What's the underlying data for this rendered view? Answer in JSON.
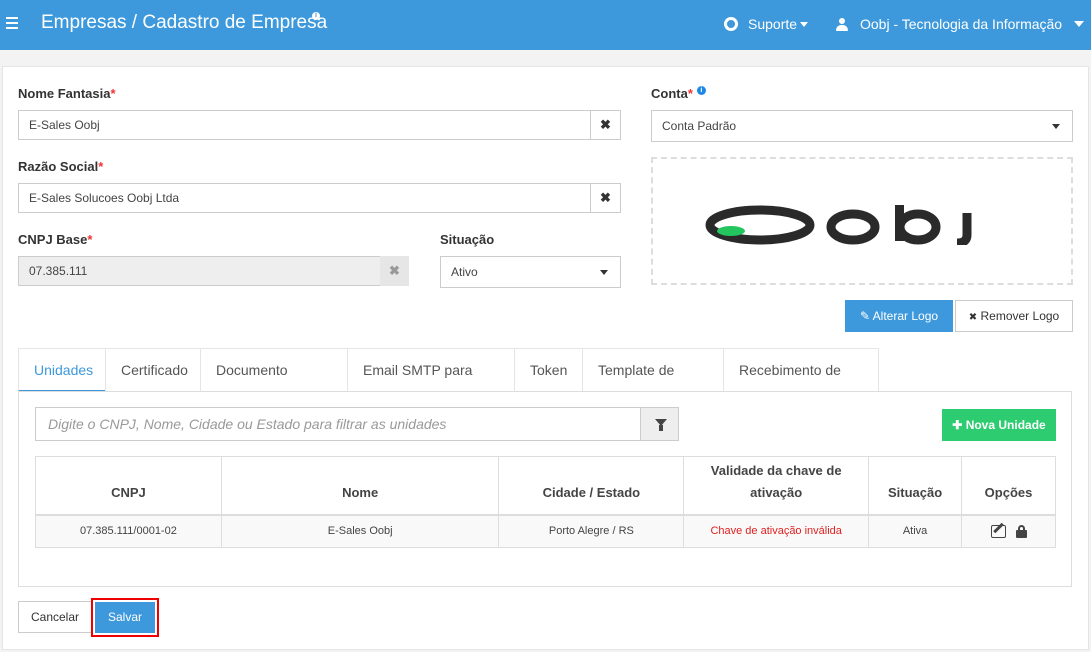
{
  "header": {
    "title": "Empresas / Cadastro de Empresa",
    "info_marker": "i",
    "support_label": "Suporte",
    "user_label": "Oobj - Tecnologia da Informação"
  },
  "form": {
    "nome_fantasia": {
      "label": "Nome Fantasia",
      "required": "*",
      "value": "E-Sales Oobj",
      "clear": "✖"
    },
    "razao_social": {
      "label": "Razão Social",
      "required": "*",
      "value": "E-Sales Solucoes Oobj Ltda",
      "clear": "✖"
    },
    "cnpj_base": {
      "label": "CNPJ Base",
      "required": "*",
      "value": "07.385.111",
      "clear": "✖"
    },
    "situacao": {
      "label": "Situação",
      "value": "Ativo"
    },
    "conta": {
      "label": "Conta",
      "required": "*",
      "info": "i",
      "value": "Conta Padrão"
    }
  },
  "logo": {
    "alter_label": "Alterar Logo",
    "remove_label": "Remover Logo",
    "alter_icon": "✎",
    "remove_icon": "✖"
  },
  "tabs": [
    {
      "label": "Unidades"
    },
    {
      "label": "Certificado"
    },
    {
      "label": "Documento Auxiliar"
    },
    {
      "label": "Email SMTP para Envio"
    },
    {
      "label": "Token"
    },
    {
      "label": "Template de Email"
    },
    {
      "label": "Recebimento de DF-e"
    }
  ],
  "unidades": {
    "filter_placeholder": "Digite o CNPJ, Nome, Cidade ou Estado para filtrar as unidades",
    "new_button": "Nova Unidade",
    "new_icon": "✚",
    "columns": [
      "CNPJ",
      "Nome",
      "Cidade / Estado",
      "Validade da chave de ativação",
      "Situação",
      "Opções"
    ],
    "rows": [
      {
        "cnpj": "07.385.111/0001-02",
        "nome": "E-Sales Oobj",
        "cidade": "Porto Alegre / RS",
        "validade": "Chave de ativação inválida",
        "situacao": "Ativa"
      }
    ]
  },
  "footer": {
    "cancel_label": "Cancelar",
    "save_label": "Salvar"
  }
}
